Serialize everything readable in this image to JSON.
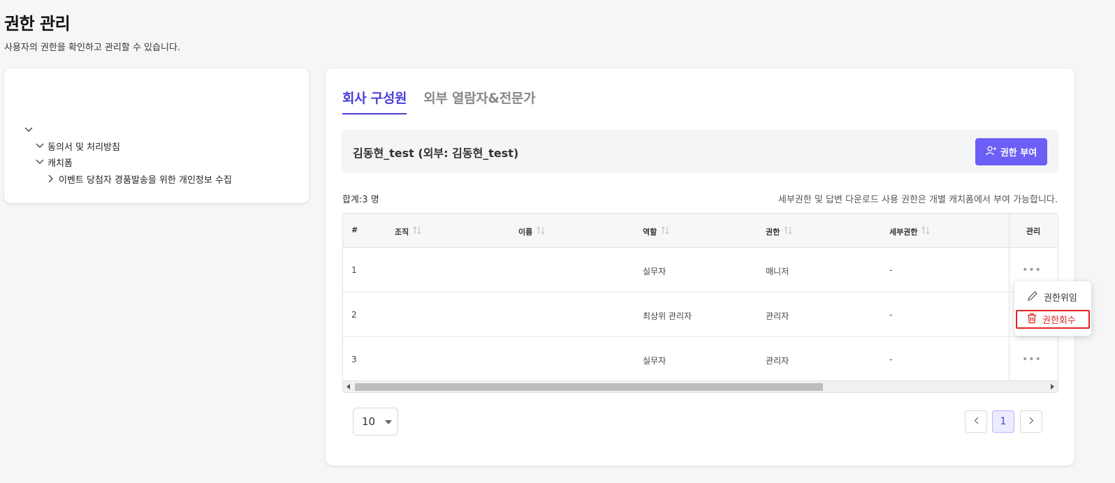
{
  "header": {
    "title": "권한 관리",
    "subtitle": "사용자의 권한을 확인하고 관리할 수 있습니다."
  },
  "tree": {
    "items": [
      {
        "label": "",
        "expanded": true
      },
      {
        "label": "동의서 및 처리방침",
        "expanded": true
      },
      {
        "label": "캐치폼",
        "expanded": true
      },
      {
        "label": "이벤트 당첨자 경품발송을 위한 개인정보 수집",
        "expanded": false
      }
    ]
  },
  "tabs": [
    {
      "label": "회사 구성원",
      "active": true
    },
    {
      "label": "외부 열람자&전문가",
      "active": false
    }
  ],
  "member_bar": {
    "name": "김동현_test (외부: 김동현_test)",
    "grant_button": "권한 부여"
  },
  "summary": {
    "total": "합계:3 명",
    "notice": "세부권한 및 답변 다운로드 사용 권한은 개별 캐치폼에서 부여 가능합니다."
  },
  "table": {
    "columns": [
      "#",
      "조직",
      "이름",
      "역할",
      "권한",
      "세부권한",
      "관리"
    ],
    "rows": [
      {
        "num": "1",
        "org": "",
        "name": "",
        "role": "실무자",
        "perm": "매니저",
        "detail": "-"
      },
      {
        "num": "2",
        "org": "",
        "name": "",
        "role": "최상위 관리자",
        "perm": "관리자",
        "detail": "-"
      },
      {
        "num": "3",
        "org": "",
        "name": "",
        "role": "실무자",
        "perm": "관리자",
        "detail": "-"
      }
    ],
    "more_label": "•••"
  },
  "pagination": {
    "page_size": "10",
    "current_page": "1",
    "prev": "‹",
    "next": "›"
  },
  "context_menu": {
    "delegate": "권한위임",
    "revoke": "권한회수"
  },
  "colors": {
    "accent": "#6c5ff5",
    "active_tab": "#4a3fd8",
    "danger": "#e02020"
  }
}
